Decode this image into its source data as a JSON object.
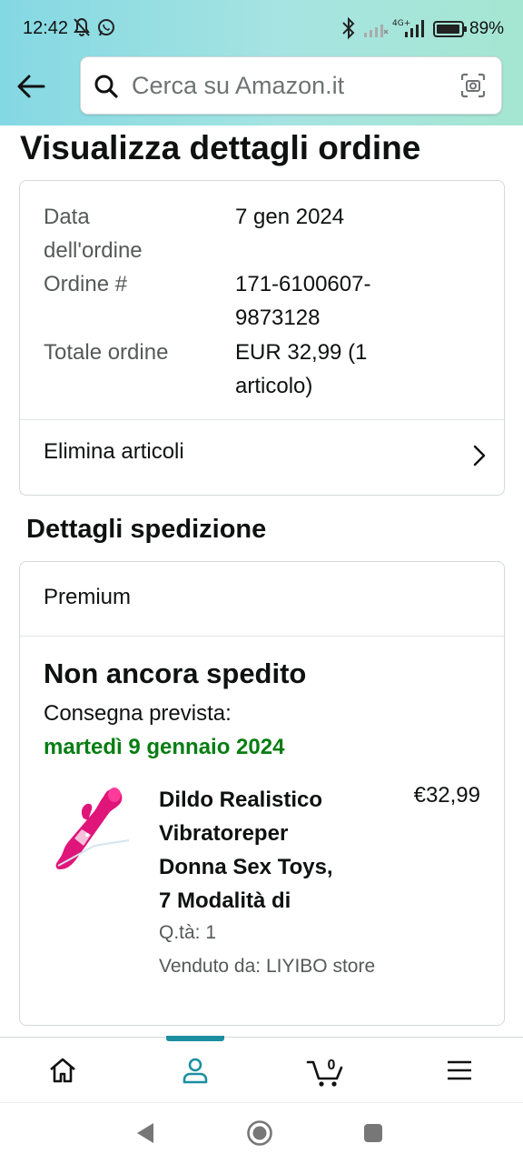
{
  "status_bar": {
    "time": "12:42",
    "battery_percent": "89%",
    "network": "4G+",
    "icons": [
      "mute-icon",
      "whatsapp-icon",
      "bluetooth-icon",
      "signal-icon",
      "battery-icon"
    ]
  },
  "header": {
    "search_placeholder": "Cerca su Amazon.it",
    "icons": [
      "back-arrow-icon",
      "search-icon",
      "camera-scan-icon"
    ]
  },
  "page": {
    "title": "Visualizza dettagli ordine"
  },
  "order_summary": {
    "date_label_line1": "Data",
    "date_label_line2": "dell'ordine",
    "date_value": "7 gen 2024",
    "number_label": "Ordine #",
    "number_value_line1": "171-6100607-",
    "number_value_line2": "9873128",
    "total_label": "Totale ordine",
    "total_value_line1": "EUR 32,99 (1",
    "total_value_line2": "articolo)",
    "action_label": "Elimina articoli"
  },
  "shipping": {
    "section_title": "Dettagli spedizione",
    "service": "Premium",
    "status": "Non ancora spedito",
    "eta_label": "Consegna prevista:",
    "eta_date": "martedì 9 gennaio 2024",
    "accent_color": "#067d12",
    "item": {
      "title_line1": "Dildo Realistico",
      "title_line2": "Vibratoreper",
      "title_line3": "Donna Sex Toys,",
      "title_line4": "7 Modalità di",
      "price": "€32,99",
      "quantity": "Q.tà: 1",
      "seller": "Venduto da: LIYIBO store",
      "image_icon": "product-image"
    }
  },
  "bottom_nav": {
    "items": [
      "home-icon",
      "account-icon",
      "cart-icon",
      "menu-icon"
    ],
    "cart_count": "0",
    "active": "account-icon",
    "accent": "#1b8fa0"
  },
  "system_nav": [
    "back-triangle-icon",
    "home-circle-icon",
    "recents-square-icon"
  ]
}
